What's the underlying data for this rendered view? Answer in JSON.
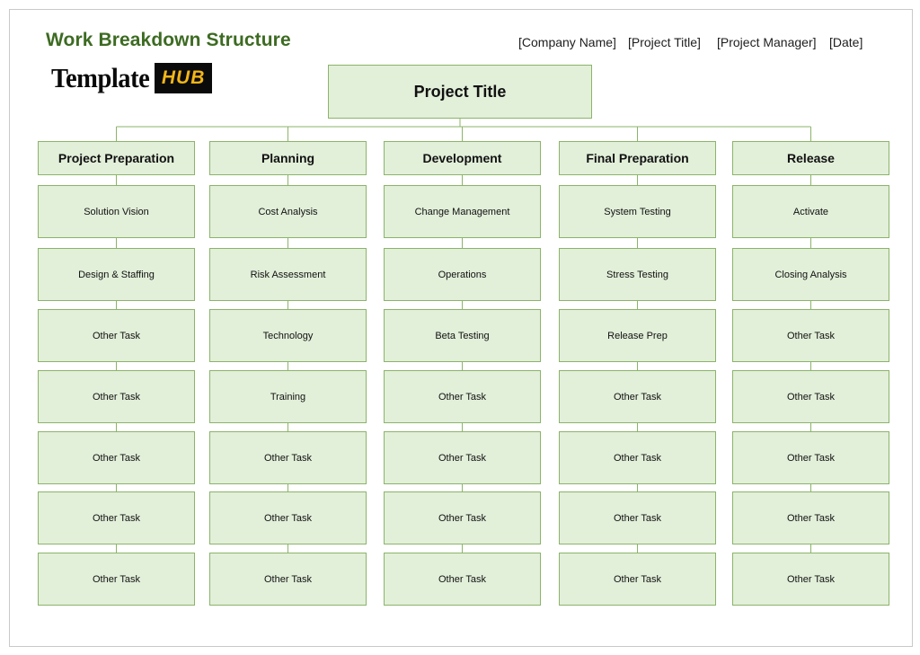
{
  "document": {
    "title": "Work Breakdown Structure",
    "logo_text": "Template",
    "logo_badge": "HUB",
    "meta": {
      "company": "[Company Name]",
      "project_title": "[Project Title]",
      "project_manager": "[Project Manager]",
      "date": "[Date]"
    }
  },
  "wbs": {
    "root": "Project Title",
    "phases": [
      {
        "name": "Project Preparation",
        "tasks": [
          "Solution Vision",
          "Design & Staffing",
          "Other Task",
          "Other Task",
          "Other Task",
          "Other Task",
          "Other Task"
        ]
      },
      {
        "name": "Planning",
        "tasks": [
          "Cost Analysis",
          "Risk Assessment",
          "Technology",
          "Training",
          "Other Task",
          "Other Task",
          "Other Task"
        ]
      },
      {
        "name": "Development",
        "tasks": [
          "Change Management",
          "Operations",
          "Beta Testing",
          "Other Task",
          "Other Task",
          "Other Task",
          "Other Task"
        ]
      },
      {
        "name": "Final Preparation",
        "tasks": [
          "System Testing",
          "Stress Testing",
          "Release Prep",
          "Other Task",
          "Other Task",
          "Other Task",
          "Other Task"
        ]
      },
      {
        "name": "Release",
        "tasks": [
          "Activate",
          "Closing Analysis",
          "Other Task",
          "Other Task",
          "Other Task",
          "Other Task",
          "Other Task"
        ]
      }
    ]
  },
  "colors": {
    "box_fill": "#e2efd9",
    "box_border": "#8bb46a",
    "title_green": "#3d6b22",
    "logo_badge_bg": "#0a0a0a",
    "logo_badge_text": "#f3b619"
  }
}
